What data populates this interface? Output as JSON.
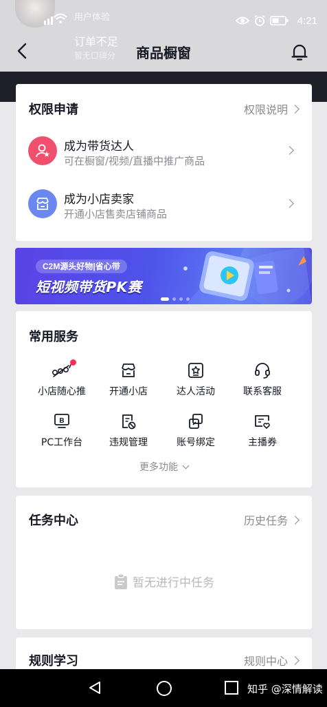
{
  "status_bar": {
    "time": "4:21"
  },
  "background_ghost": {
    "user_text": "用户体验",
    "order_text": "订单不足",
    "sub_text": "暂无口碑分"
  },
  "header": {
    "title": "商品橱窗"
  },
  "permission": {
    "title": "权限申请",
    "link": "权限说明",
    "items": [
      {
        "title": "成为带货达人",
        "desc": "可在橱窗/视频/直播中推广商品",
        "icon": "person-star-icon",
        "color": "#f0506e"
      },
      {
        "title": "成为小店卖家",
        "desc": "开通小店售卖店铺商品",
        "icon": "store-icon",
        "color": "#6b87f0"
      }
    ]
  },
  "banner": {
    "tag": "C2M源头好物|省心带",
    "headline": "短视频带货PK赛"
  },
  "services": {
    "title": "常用服务",
    "items": [
      {
        "label": "小店随心推",
        "icon": "promote-icon",
        "badge": true
      },
      {
        "label": "开通小店",
        "icon": "open-store-icon"
      },
      {
        "label": "达人活动",
        "icon": "activity-star-icon"
      },
      {
        "label": "联系客服",
        "icon": "headset-icon"
      },
      {
        "label": "PC工作台",
        "icon": "pc-workbench-icon"
      },
      {
        "label": "违规管理",
        "icon": "violation-doc-icon"
      },
      {
        "label": "账号绑定",
        "icon": "account-link-icon"
      },
      {
        "label": "主播券",
        "icon": "anchor-coupon-icon"
      }
    ],
    "more": "更多功能"
  },
  "tasks": {
    "title": "任务中心",
    "link": "历史任务",
    "empty_text": "暂无进行中任务"
  },
  "rules": {
    "title": "规则学习",
    "link": "规则中心"
  },
  "watermark": "知乎 @深情解读"
}
